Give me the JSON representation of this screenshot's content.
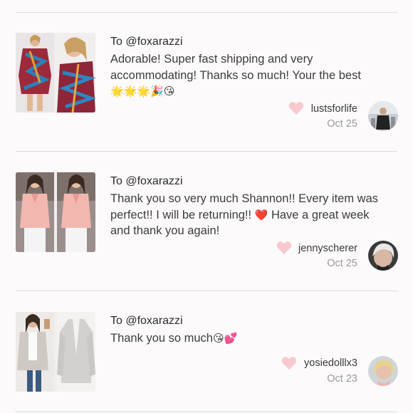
{
  "reviews": [
    {
      "to": "To @foxarazzi",
      "message": "Adorable! Super fast shipping and very accommodating! Thanks so much! Your the best",
      "emojis": "🌟🌟🌟🎉😘",
      "username": "lustsforlife",
      "date": "Oct 25"
    },
    {
      "to": "To @foxarazzi",
      "message_a": "Thank you so very much Shannon!! Every item was perfect!! I will be returning!! ",
      "emoji_mid": "❤️",
      "message_b": " Have a great week and thank you again!",
      "username": "jennyscherer",
      "date": "Oct 25"
    },
    {
      "to": "To @foxarazzi",
      "message": "Thank you so much",
      "emojis": "😘💕",
      "username": "yosiedolllx3",
      "date": "Oct 23"
    }
  ],
  "colors": {
    "heart": "#f7c9cf",
    "divider": "#dcdcdc",
    "muted_text": "#9a9a9a"
  },
  "icons": {
    "like": "heart-icon"
  }
}
